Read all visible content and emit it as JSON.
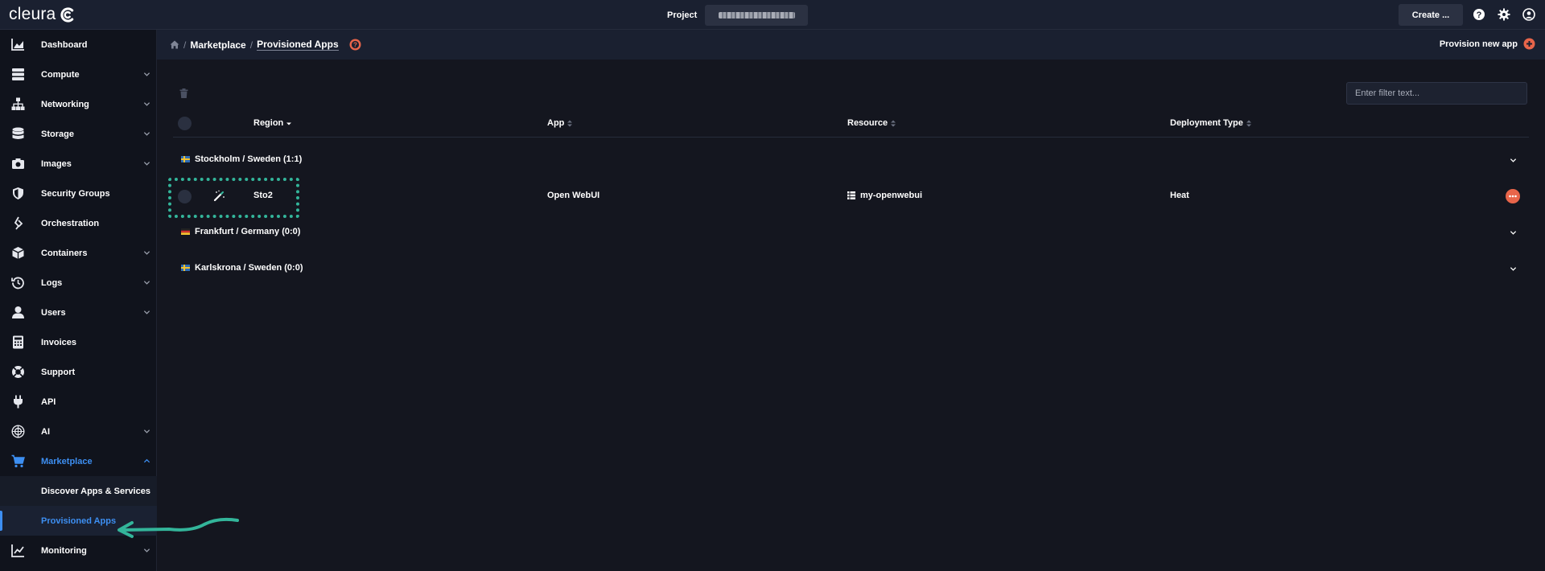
{
  "topbar": {
    "logo_text": "cleura",
    "project_label": "Project",
    "create_label": "Create ...",
    "icons": [
      "help-icon",
      "settings-gear-icon",
      "user-account-icon"
    ]
  },
  "sidebar": {
    "items": [
      {
        "label": "Dashboard",
        "icon": "dashboard-chart-icon",
        "expandable": false
      },
      {
        "label": "Compute",
        "icon": "compute-server-icon",
        "expandable": true
      },
      {
        "label": "Networking",
        "icon": "networking-icon",
        "expandable": true
      },
      {
        "label": "Storage",
        "icon": "storage-database-icon",
        "expandable": true
      },
      {
        "label": "Images",
        "icon": "camera-icon",
        "expandable": true
      },
      {
        "label": "Security Groups",
        "icon": "shield-icon",
        "expandable": false
      },
      {
        "label": "Orchestration",
        "icon": "orchestration-icon",
        "expandable": false
      },
      {
        "label": "Containers",
        "icon": "cube-icon",
        "expandable": true
      },
      {
        "label": "Logs",
        "icon": "history-icon",
        "expandable": true
      },
      {
        "label": "Users",
        "icon": "user-icon",
        "expandable": true
      },
      {
        "label": "Invoices",
        "icon": "calculator-icon",
        "expandable": false
      },
      {
        "label": "Support",
        "icon": "lifebuoy-icon",
        "expandable": false
      },
      {
        "label": "API",
        "icon": "plug-icon",
        "expandable": false
      },
      {
        "label": "AI",
        "icon": "ai-chip-icon",
        "expandable": true
      },
      {
        "label": "Marketplace",
        "icon": "cart-icon",
        "expandable": true,
        "expanded": true
      },
      {
        "label": "Monitoring",
        "icon": "monitoring-chart-icon",
        "expandable": true
      }
    ],
    "marketplace_sub": [
      {
        "label": "Discover Apps & Services",
        "selected": false
      },
      {
        "label": "Provisioned Apps",
        "selected": true
      }
    ]
  },
  "breadcrumb": {
    "items": [
      "Marketplace",
      "Provisioned Apps"
    ],
    "separator": "/"
  },
  "provision_label": "Provision new app",
  "filter_placeholder": "Enter filter text...",
  "table": {
    "headers": {
      "region": "Region",
      "app": "App",
      "resource": "Resource",
      "deployment_type": "Deployment Type"
    },
    "groups": [
      {
        "label": "Stockholm / Sweden (1:1)",
        "flag": "sweden"
      },
      {
        "label": "Frankfurt / Germany (0:0)",
        "flag": "germany"
      },
      {
        "label": "Karlskrona / Sweden (0:0)",
        "flag": "sweden"
      }
    ],
    "rows": [
      {
        "region": "Sto2",
        "app": "Open WebUI",
        "resource": "my-openwebui",
        "deployment_type": "Heat"
      }
    ]
  },
  "colors": {
    "accent_blue": "#3d8ff2",
    "accent_orange": "#e8654a",
    "annotation_teal": "#33b59a",
    "background": "#14161f"
  }
}
